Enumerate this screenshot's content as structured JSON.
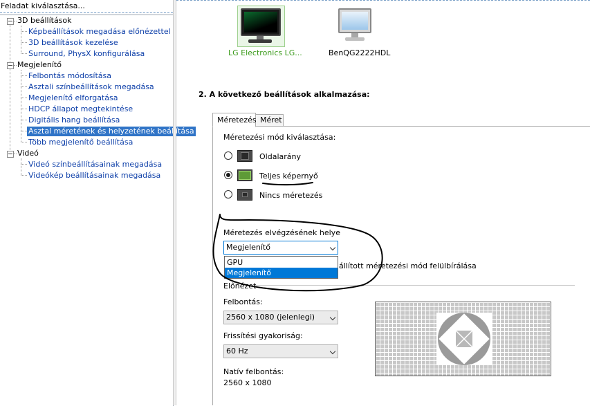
{
  "left_panel": {
    "header": "Feladat kiválasztása...",
    "tree": [
      {
        "label": "3D beállítások",
        "children": [
          "Képbeállítások megadása előnézettel",
          "3D beállítások kezelése",
          "Surround, PhysX konfigurálása"
        ]
      },
      {
        "label": "Megjelenítő",
        "children": [
          "Felbontás módosítása",
          "Asztali színbeállítások megadása",
          "Megjelenítő elforgatása",
          "HDCP állapot megtekintése",
          "Digitális hang beállítása",
          "Asztal méretének és helyzetének beállítása",
          "Több megjelenítő beállítása"
        ]
      },
      {
        "label": "Videó",
        "children": [
          "Videó színbeállításainak megadása",
          "Videókép beállításainak megadása"
        ]
      }
    ],
    "selected": "Asztal méretének és helyzetének beállítása"
  },
  "displays": [
    {
      "name": "LG Electronics LG...",
      "selected": true
    },
    {
      "name": "BenQG2222HDL",
      "selected": false
    }
  ],
  "section_title": "2. A következő beállítások alkalmazása:",
  "tabs": [
    {
      "label": "Méretezés",
      "active": true
    },
    {
      "label": "Méret",
      "active": false
    }
  ],
  "scaling_mode": {
    "label": "Méretezési mód kiválasztása:",
    "options": [
      {
        "label": "Oldalarány",
        "checked": false,
        "icon": "aspect-ratio-icon"
      },
      {
        "label": "Teljes képernyő",
        "checked": true,
        "icon": "full-screen-icon"
      },
      {
        "label": "Nincs méretezés",
        "checked": false,
        "icon": "no-scaling-icon"
      }
    ]
  },
  "scaling_location": {
    "label": "Méretezés elvégzésének helye",
    "value": "Megjelenítő",
    "options": [
      "GPU",
      "Megjelenítő"
    ],
    "selected_option": "Megjelenítő"
  },
  "override_text": "állított méretezési mód felülbírálása",
  "preview": {
    "label": "Előnézet",
    "resolution_label": "Felbontás:",
    "resolution_value": "2560 x 1080 (jelenlegi)",
    "refresh_label": "Frissítési gyakoriság:",
    "refresh_value": "60 Hz",
    "native_label": "Natív felbontás:",
    "native_value": "2560 x 1080"
  },
  "colors": {
    "selection": "#3074c7",
    "link": "#0c3ea8",
    "selected_display_text": "#3a9a1a",
    "annotation": "#000000"
  }
}
